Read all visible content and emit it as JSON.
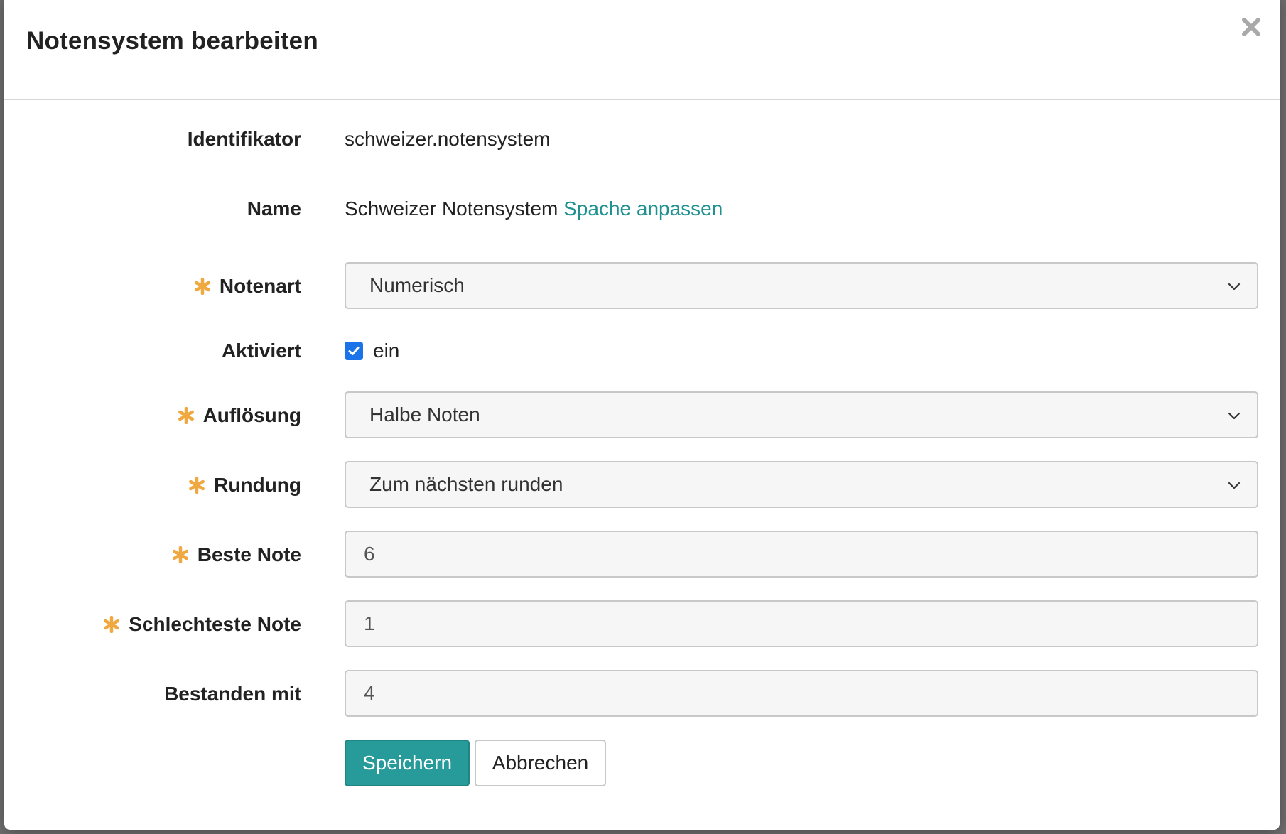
{
  "dialog": {
    "title": "Notensystem bearbeiten"
  },
  "form": {
    "identifier": {
      "label": "Identifikator",
      "value": "schweizer.notensystem"
    },
    "name": {
      "label": "Name",
      "value": "Schweizer Notensystem",
      "link_label": "Spache anpassen"
    },
    "grade_type": {
      "label": "Notenart",
      "selected": "Numerisch",
      "required": true
    },
    "activated": {
      "label": "Aktiviert",
      "checkbox_label": "ein",
      "checked": true
    },
    "resolution": {
      "label": "Auflösung",
      "selected": "Halbe Noten",
      "required": true
    },
    "rounding": {
      "label": "Rundung",
      "selected": "Zum nächsten runden",
      "required": true
    },
    "best_grade": {
      "label": "Beste Note",
      "value": "6",
      "required": true
    },
    "worst_grade": {
      "label": "Schlechteste Note",
      "value": "1",
      "required": true
    },
    "passed_with": {
      "label": "Bestanden mit",
      "value": "4"
    }
  },
  "actions": {
    "save_label": "Speichern",
    "cancel_label": "Abbrechen"
  },
  "colors": {
    "accent": "#279a9a",
    "link": "#1f9191",
    "required_marker": "#f0a840",
    "checkbox": "#1a73e8"
  },
  "icons": {
    "close": "close-icon",
    "required": "asterisk-icon",
    "dropdown": "chevron-down-icon",
    "check": "checkmark-icon"
  }
}
